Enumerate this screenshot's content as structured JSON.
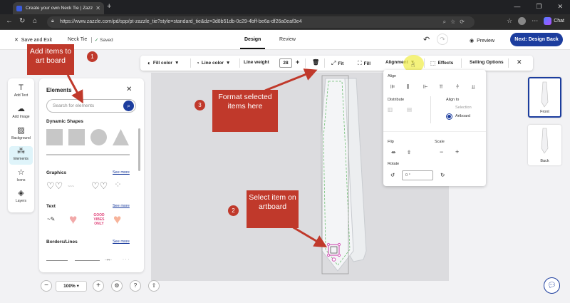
{
  "browser": {
    "tab_title": "Create your own Neck Tie | Zazzle",
    "url": "https://www.zazzle.com/pd/spp/pt-zazzle_tie?style=standard_tie&dz=3d8b51db-0c29-4bff-be6a-df26a0eaf3e4",
    "chat_label": "Chat"
  },
  "header": {
    "save_exit": "Save and Exit",
    "doc_name": "Neck Tie",
    "saved": "Saved",
    "tab_design": "Design",
    "tab_review": "Review",
    "preview": "Preview",
    "next": "Next: Design Back"
  },
  "toolbar": {
    "fill_color": "Fill color",
    "line_color": "Line color",
    "line_weight": "Line weight",
    "line_weight_value": "28",
    "fit": "Fit",
    "fill": "Fill",
    "alignment": "Alignment",
    "effects": "Effects",
    "selling_options": "Selling Options"
  },
  "rail": [
    {
      "label": "Add Text",
      "icon": "text-icon"
    },
    {
      "label": "Add Image",
      "icon": "cloud-upload-icon"
    },
    {
      "label": "Background",
      "icon": "image-icon"
    },
    {
      "label": "Elements",
      "icon": "elements-icon"
    },
    {
      "label": "Icons",
      "icon": "star-icon"
    },
    {
      "label": "Layers",
      "icon": "layers-icon"
    }
  ],
  "panel": {
    "title": "Elements",
    "search_placeholder": "Search for elements",
    "dynamic_shapes": "Dynamic Shapes",
    "graphics": "Graphics",
    "text": "Text",
    "borders": "Borders/Lines",
    "see_more": "See more"
  },
  "zoom": {
    "value": "100%"
  },
  "thumbs": {
    "front": "Front",
    "back": "Back"
  },
  "align": {
    "align": "Align",
    "distribute": "Distribute",
    "align_to": "Align to",
    "selection": "Selection",
    "artboard": "Artboard",
    "flip": "Flip",
    "scale": "Scale",
    "rotate": "Rotate",
    "rotate_value": "0 °"
  },
  "callouts": {
    "c1_text": "Add items to art board",
    "c1_num": "1",
    "c2_text": "Select item on artboard",
    "c2_num": "2",
    "c3_text": "Format selected items here",
    "c3_num": "3"
  },
  "colors": {
    "accent": "#1c3d9e",
    "callout": "#c0392b"
  }
}
